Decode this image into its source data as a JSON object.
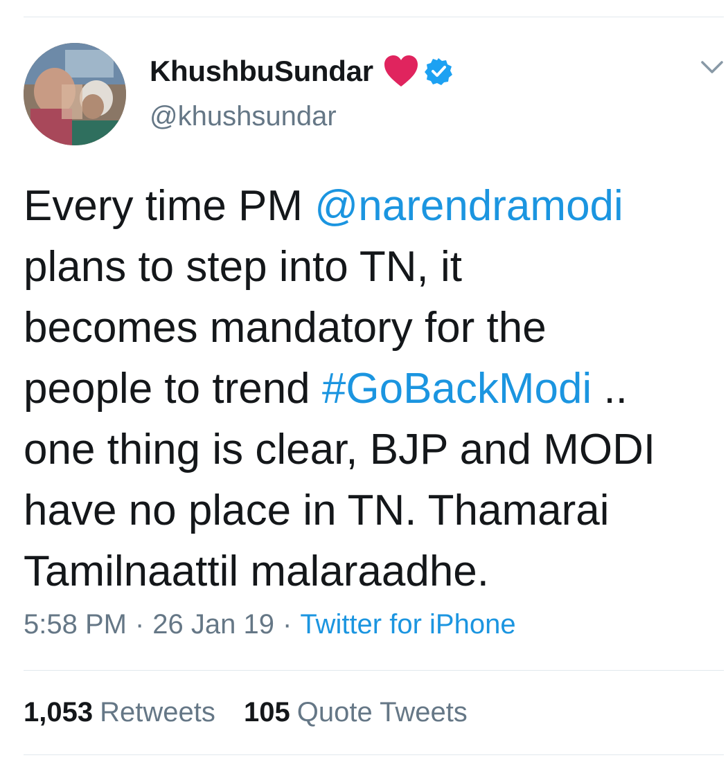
{
  "author": {
    "display_name": "KhushbuSundar",
    "handle": "@khushsundar",
    "emoji_icon": "red-heart-icon",
    "verified_icon": "verified-badge-icon"
  },
  "tweet": {
    "lines": [
      [
        {
          "text": "Every time PM "
        },
        {
          "text": "@narendramodi",
          "link": true
        }
      ],
      [
        {
          "text": "plans to step into TN, it"
        }
      ],
      [
        {
          "text": "becomes mandatory for the"
        }
      ],
      [
        {
          "text": "people to trend "
        },
        {
          "text": "#GoBackModi",
          "link": true
        },
        {
          "text": " .."
        }
      ],
      [
        {
          "text": "one thing is clear, BJP and MODI"
        }
      ],
      [
        {
          "text": "have no place in TN. Thamarai"
        }
      ],
      [
        {
          "text": "Tamilnaattil malaraadhe."
        }
      ]
    ]
  },
  "meta": {
    "time": "5:58 PM",
    "separator": "·",
    "date": "26 Jan 19",
    "source": "Twitter for iPhone"
  },
  "stats": {
    "retweets_count": "1,053",
    "retweets_label": "Retweets",
    "quotes_count": "105",
    "quotes_label": "Quote Tweets"
  },
  "colors": {
    "link": "#1b95e0",
    "secondary_text": "#657786",
    "primary_text": "#14171a",
    "heart": "#e0245e",
    "verified": "#1da1f2"
  }
}
